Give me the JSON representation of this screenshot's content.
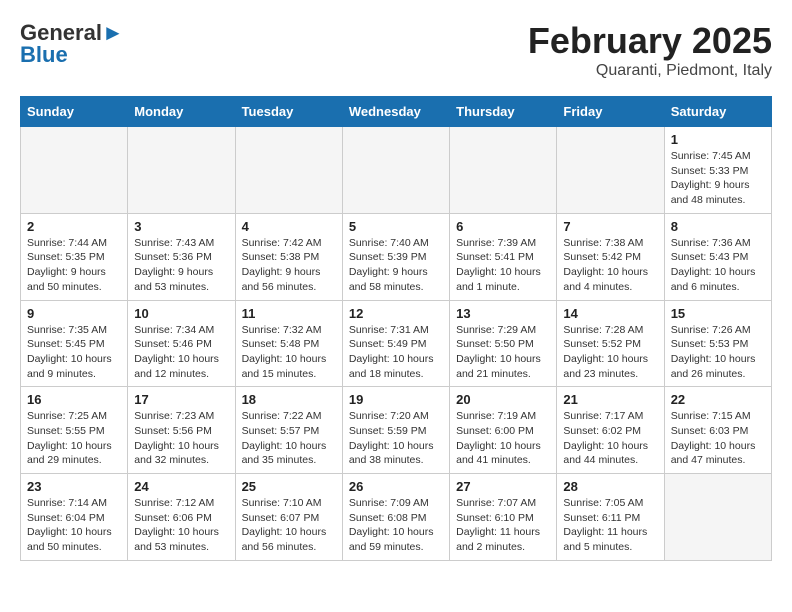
{
  "logo": {
    "general": "General",
    "blue": "Blue"
  },
  "header": {
    "month": "February 2025",
    "location": "Quaranti, Piedmont, Italy"
  },
  "weekdays": [
    "Sunday",
    "Monday",
    "Tuesday",
    "Wednesday",
    "Thursday",
    "Friday",
    "Saturday"
  ],
  "weeks": [
    [
      {
        "day": "",
        "info": ""
      },
      {
        "day": "",
        "info": ""
      },
      {
        "day": "",
        "info": ""
      },
      {
        "day": "",
        "info": ""
      },
      {
        "day": "",
        "info": ""
      },
      {
        "day": "",
        "info": ""
      },
      {
        "day": "1",
        "info": "Sunrise: 7:45 AM\nSunset: 5:33 PM\nDaylight: 9 hours\nand 48 minutes."
      }
    ],
    [
      {
        "day": "2",
        "info": "Sunrise: 7:44 AM\nSunset: 5:35 PM\nDaylight: 9 hours\nand 50 minutes."
      },
      {
        "day": "3",
        "info": "Sunrise: 7:43 AM\nSunset: 5:36 PM\nDaylight: 9 hours\nand 53 minutes."
      },
      {
        "day": "4",
        "info": "Sunrise: 7:42 AM\nSunset: 5:38 PM\nDaylight: 9 hours\nand 56 minutes."
      },
      {
        "day": "5",
        "info": "Sunrise: 7:40 AM\nSunset: 5:39 PM\nDaylight: 9 hours\nand 58 minutes."
      },
      {
        "day": "6",
        "info": "Sunrise: 7:39 AM\nSunset: 5:41 PM\nDaylight: 10 hours\nand 1 minute."
      },
      {
        "day": "7",
        "info": "Sunrise: 7:38 AM\nSunset: 5:42 PM\nDaylight: 10 hours\nand 4 minutes."
      },
      {
        "day": "8",
        "info": "Sunrise: 7:36 AM\nSunset: 5:43 PM\nDaylight: 10 hours\nand 6 minutes."
      }
    ],
    [
      {
        "day": "9",
        "info": "Sunrise: 7:35 AM\nSunset: 5:45 PM\nDaylight: 10 hours\nand 9 minutes."
      },
      {
        "day": "10",
        "info": "Sunrise: 7:34 AM\nSunset: 5:46 PM\nDaylight: 10 hours\nand 12 minutes."
      },
      {
        "day": "11",
        "info": "Sunrise: 7:32 AM\nSunset: 5:48 PM\nDaylight: 10 hours\nand 15 minutes."
      },
      {
        "day": "12",
        "info": "Sunrise: 7:31 AM\nSunset: 5:49 PM\nDaylight: 10 hours\nand 18 minutes."
      },
      {
        "day": "13",
        "info": "Sunrise: 7:29 AM\nSunset: 5:50 PM\nDaylight: 10 hours\nand 21 minutes."
      },
      {
        "day": "14",
        "info": "Sunrise: 7:28 AM\nSunset: 5:52 PM\nDaylight: 10 hours\nand 23 minutes."
      },
      {
        "day": "15",
        "info": "Sunrise: 7:26 AM\nSunset: 5:53 PM\nDaylight: 10 hours\nand 26 minutes."
      }
    ],
    [
      {
        "day": "16",
        "info": "Sunrise: 7:25 AM\nSunset: 5:55 PM\nDaylight: 10 hours\nand 29 minutes."
      },
      {
        "day": "17",
        "info": "Sunrise: 7:23 AM\nSunset: 5:56 PM\nDaylight: 10 hours\nand 32 minutes."
      },
      {
        "day": "18",
        "info": "Sunrise: 7:22 AM\nSunset: 5:57 PM\nDaylight: 10 hours\nand 35 minutes."
      },
      {
        "day": "19",
        "info": "Sunrise: 7:20 AM\nSunset: 5:59 PM\nDaylight: 10 hours\nand 38 minutes."
      },
      {
        "day": "20",
        "info": "Sunrise: 7:19 AM\nSunset: 6:00 PM\nDaylight: 10 hours\nand 41 minutes."
      },
      {
        "day": "21",
        "info": "Sunrise: 7:17 AM\nSunset: 6:02 PM\nDaylight: 10 hours\nand 44 minutes."
      },
      {
        "day": "22",
        "info": "Sunrise: 7:15 AM\nSunset: 6:03 PM\nDaylight: 10 hours\nand 47 minutes."
      }
    ],
    [
      {
        "day": "23",
        "info": "Sunrise: 7:14 AM\nSunset: 6:04 PM\nDaylight: 10 hours\nand 50 minutes."
      },
      {
        "day": "24",
        "info": "Sunrise: 7:12 AM\nSunset: 6:06 PM\nDaylight: 10 hours\nand 53 minutes."
      },
      {
        "day": "25",
        "info": "Sunrise: 7:10 AM\nSunset: 6:07 PM\nDaylight: 10 hours\nand 56 minutes."
      },
      {
        "day": "26",
        "info": "Sunrise: 7:09 AM\nSunset: 6:08 PM\nDaylight: 10 hours\nand 59 minutes."
      },
      {
        "day": "27",
        "info": "Sunrise: 7:07 AM\nSunset: 6:10 PM\nDaylight: 11 hours\nand 2 minutes."
      },
      {
        "day": "28",
        "info": "Sunrise: 7:05 AM\nSunset: 6:11 PM\nDaylight: 11 hours\nand 5 minutes."
      },
      {
        "day": "",
        "info": ""
      }
    ]
  ]
}
